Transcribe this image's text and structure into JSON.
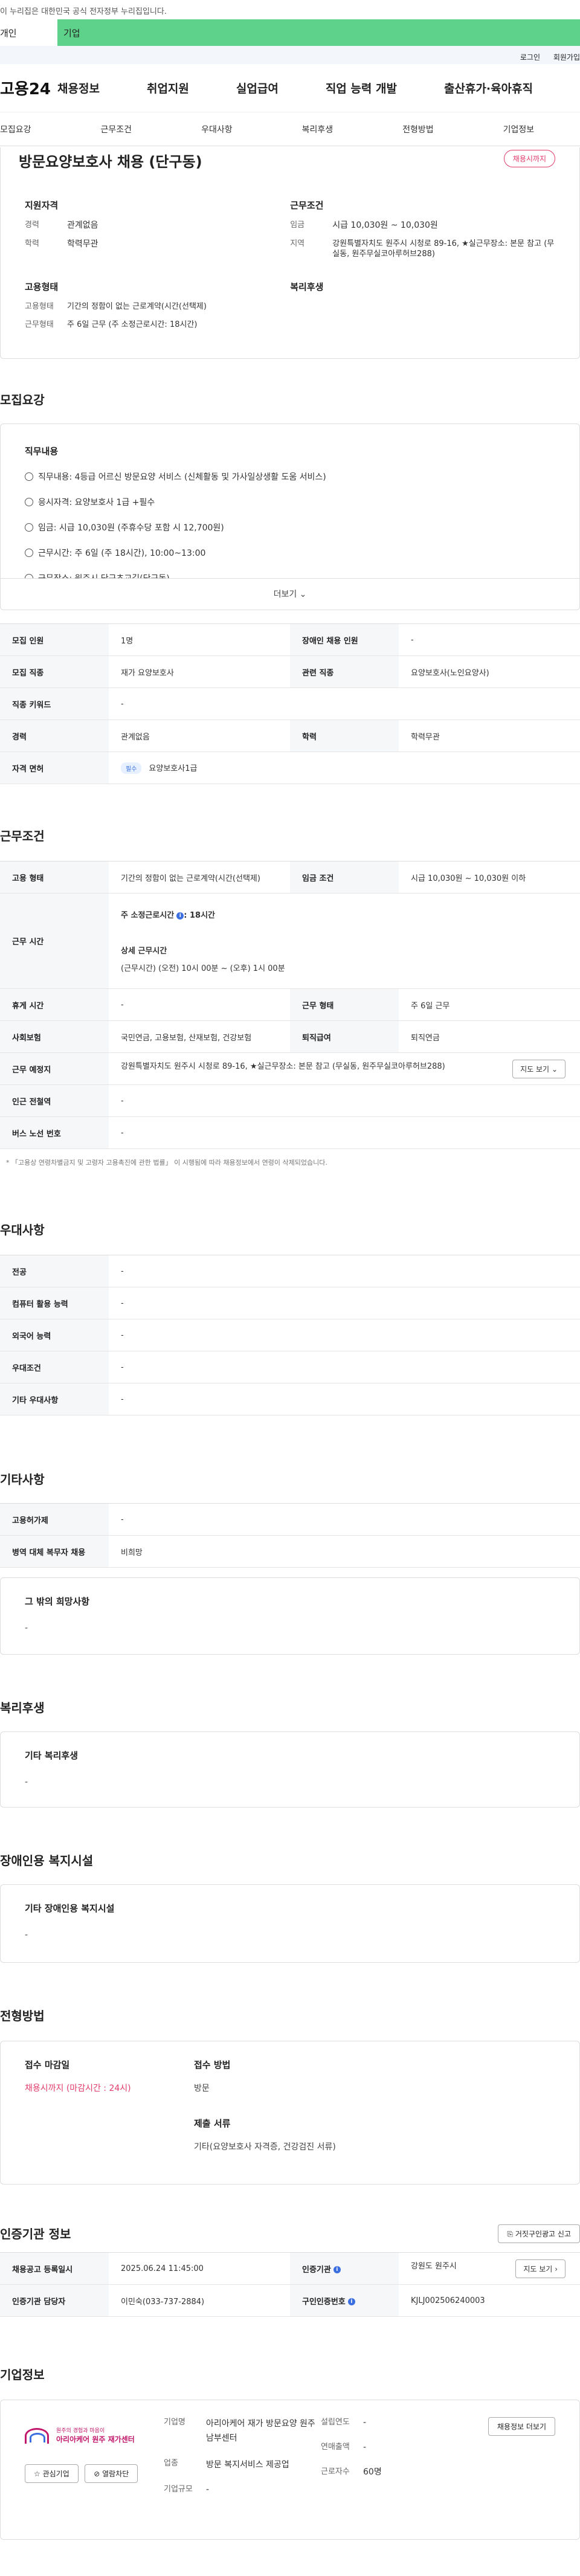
{
  "header": {
    "gov_notice": "이 누리집은 대한민국 공식 전자정부 누리집입니다.",
    "tab_left": "개인",
    "tab_right": "기업",
    "login": "로그인",
    "signup": "회원가입",
    "logo": "고용24",
    "gnb": [
      "채용정보",
      "취업지원",
      "실업급여",
      "직업 능력 개발",
      "출산휴가·육아휴직"
    ],
    "subnav": [
      "모집요강",
      "근무조건",
      "우대사항",
      "복리후생",
      "전형방법",
      "기업정보"
    ]
  },
  "summary": {
    "title": "방문요양보호사 채용 (단구동)",
    "badge": "채용시까지",
    "qual_h": "지원자격",
    "career_k": "경력",
    "career_v": "관계없음",
    "edu_k": "학력",
    "edu_v": "학력무관",
    "cond_h": "근무조건",
    "wage_k": "임금",
    "wage_v": "시급 10,030원 ~ 10,030원",
    "area_k": "지역",
    "area_v": "강원특별자치도 원주시 시청로 89-16, ★실근무장소: 본문 참고 (무실동, 원주무실코아루허브288)",
    "emp_h": "고용형태",
    "emptype_k": "고용형태",
    "emptype_v": "기간의 정함이 없는 근로계약(시간(선택제)",
    "worktype_k": "근무형태",
    "worktype_v": "주 6일 근무 (주 소정근로시간: 18시간)",
    "welfare_h": "복리후생"
  },
  "recruit": {
    "h": "모집요강",
    "duty_h": "직무내용",
    "duties": [
      "직무내용: 4등급 어르신 방문요양 서비스 (신체활동 및 가사일상생활 도움 서비스)",
      "응시자격: 요양보호사 1급 +필수",
      "임금: 시급 10,030원 (주휴수당 포함 시 12,700원)",
      "근무시간: 주 6일 (주 18시간), 10:00~13:00",
      "근무장소: 원주시 단구초교길(단구동)"
    ],
    "more": "더보기",
    "rows": [
      {
        "k1": "모집 인원",
        "v1": "1명",
        "k2": "장애인 채용 인원",
        "v2": "-"
      },
      {
        "k1": "모집 직종",
        "v1": "재가 요양보호사",
        "k2": "관련 직종",
        "v2": "요양보호사(노인요양사)"
      },
      {
        "k1": "직종 키워드",
        "v1": "-"
      },
      {
        "k1": "경력",
        "v1": "관계없음",
        "k2": "학력",
        "v2": "학력무관"
      },
      {
        "k1": "자격 면허",
        "pill": "필수",
        "v1": "요양보호사1급"
      }
    ]
  },
  "work": {
    "h": "근무조건",
    "emp_k": "고용 형태",
    "emp_v": "기간의 정함이 없는 근로계약(시간(선택제)",
    "wage_k": "임금 조건",
    "wage_v": "시급 10,030원 ~ 10,030원 이하",
    "time_k": "근무 시간",
    "time_week_label": "주 소정근로시간",
    "time_week_val": ": 18시간",
    "time_detail_h": "상세 근무시간",
    "time_detail_v": "(근무시간) (오전) 10시 00분 ~ (오후) 1시 00분",
    "rest_k": "휴게 시간",
    "rest_v": "-",
    "form_k": "근무 형태",
    "form_v": "주 6일 근무",
    "ins_k": "사회보험",
    "ins_v": "국민연금, 고용보험, 산재보험, 건강보험",
    "ret_k": "퇴직급여",
    "ret_v": "퇴직연금",
    "place_k": "근무 예정지",
    "place_v": "강원특별자치도 원주시 시청로 89-16, ★실근무장소: 본문 참고 (무실동, 원주무실코아루허브288)",
    "map_btn": "지도 보기",
    "station_k": "인근 전철역",
    "station_v": "-",
    "bus_k": "버스 노선 번호",
    "bus_v": "-",
    "note": "* 「고용상 연령차별금지 및 고령자 고용촉진에 관한 법률」 이 시행됨에 따라 채용정보에서 연령이 삭제되었습니다."
  },
  "pref": {
    "h": "우대사항",
    "rows": [
      {
        "k": "전공",
        "v": "-"
      },
      {
        "k": "컴퓨터 활용 능력",
        "v": "-"
      },
      {
        "k": "외국어 능력",
        "v": "-"
      },
      {
        "k": "우대조건",
        "v": "-"
      },
      {
        "k": "기타 우대사항",
        "v": "-"
      }
    ]
  },
  "etc": {
    "h": "기타사항",
    "rows": [
      {
        "k": "고용허가제",
        "v": "-"
      },
      {
        "k": "병역 대체 복무자 채용",
        "v": "비희망"
      }
    ],
    "wish_h": "그 밖의 희망사항",
    "wish_v": "-"
  },
  "welfare": {
    "h": "복리후생",
    "box_h": "기타 복리후생",
    "box_v": "-"
  },
  "disab": {
    "h": "장애인용 복지시설",
    "box_h": "기타 장애인용 복지시설",
    "box_v": "-"
  },
  "process": {
    "h": "전형방법",
    "deadline_h": "접수 마감일",
    "deadline_v": "채용시까지 (마감시간 : 24시)",
    "method_h": "접수 방법",
    "method_v": "방문",
    "docs_h": "제출 서류",
    "docs_v": "기타(요양보호사 자격증, 건강검진 서류)"
  },
  "cert": {
    "h": "인증기관 정보",
    "report_btn": "거짓구인광고 신고",
    "reg_k": "채용공고 등록일시",
    "reg_v": "2025.06.24 11:45:00",
    "org_k": "인증기관",
    "org_v": "강원도 원주시",
    "map_btn": "지도 보기",
    "mgr_k": "인증기관 담당자",
    "mgr_v": "이민숙(033-737-2884)",
    "auth_k": "구인인증번호",
    "auth_v": "KJLJ002506240003"
  },
  "company": {
    "h": "기업정보",
    "logo_tag": "원주의 경험과 마음이",
    "logo_name": "아리아케어 원주 재가센터",
    "fav_btn": "관심기업",
    "block_btn": "열람차단",
    "name_k": "기업명",
    "name_v": "아리아케어 재가 방문요양 원주 남부센터",
    "ind_k": "업종",
    "ind_v": "방문 복지서비스 제공업",
    "size_k": "기업규모",
    "size_v": "-",
    "est_k": "설립연도",
    "est_v": "-",
    "sales_k": "연매출액",
    "sales_v": "-",
    "emp_k": "근로자수",
    "emp_v": "60명",
    "jobs_btn": "채용정보 더보기"
  }
}
